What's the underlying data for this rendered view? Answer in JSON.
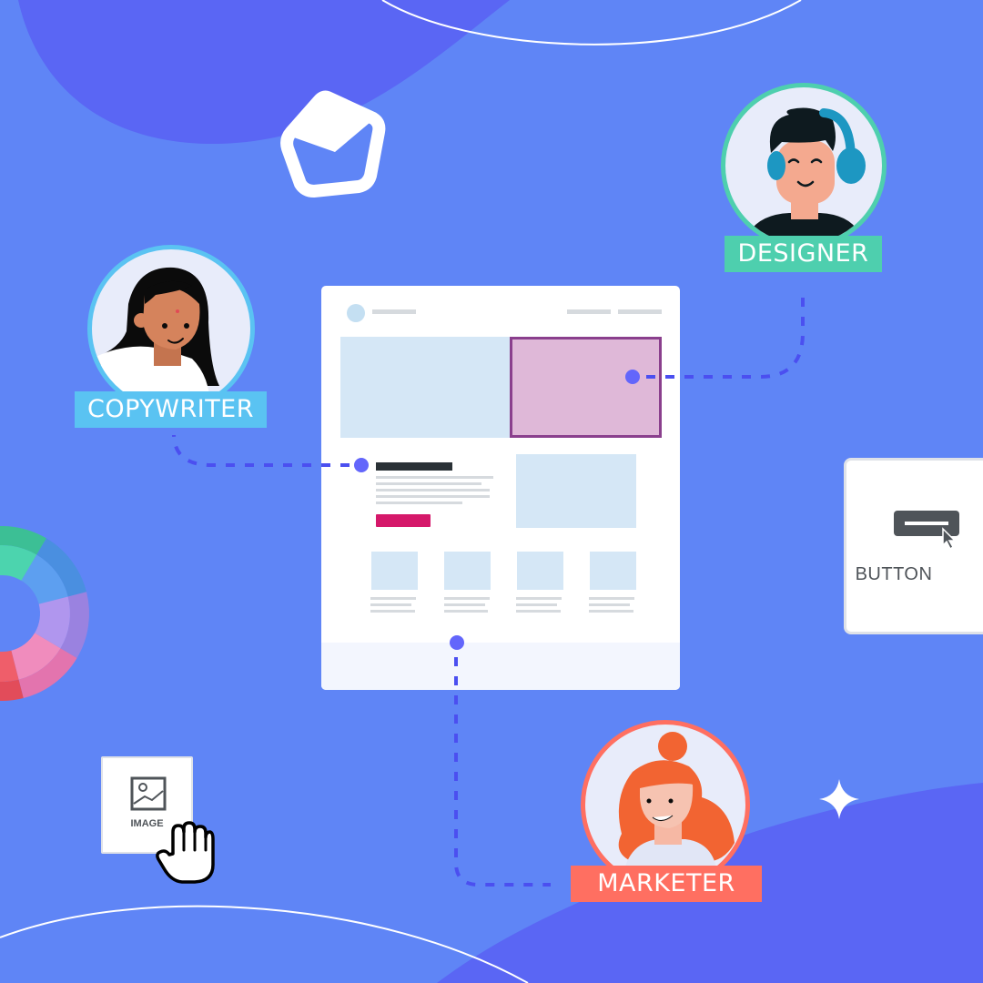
{
  "roles": {
    "designer": {
      "label": "DESIGNER",
      "color": "#4ecfae"
    },
    "copywriter": {
      "label": "COPYWRITER",
      "color": "#5ac3f2"
    },
    "marketer": {
      "label": "MARKETER",
      "color": "#ff6f61"
    }
  },
  "widgets": {
    "button_widget": {
      "label": "BUTTON",
      "icon": "button-cursor-icon"
    },
    "image_widget": {
      "label": "IMAGE",
      "icon": "image-icon",
      "cursor": "grab-hand-icon"
    }
  },
  "colors": {
    "background": "#5f85f6",
    "blob": "#5a66f4",
    "connector": "#4b4ff0",
    "highlight_fill": "#dfb8d8",
    "highlight_border": "#8a3f8d",
    "cta": "#d5186a",
    "placeholder": "#d5e7f6"
  },
  "decorations": [
    "cube-icon",
    "color-wheel",
    "sparkle-icon"
  ]
}
